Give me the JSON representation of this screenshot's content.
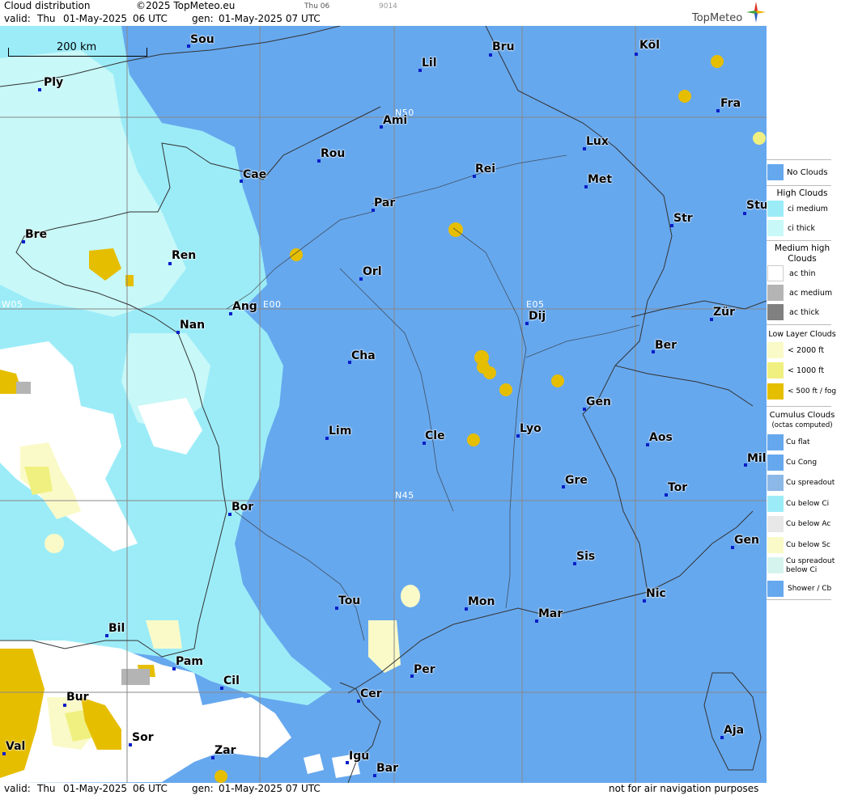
{
  "header": {
    "title": "Cloud distribution",
    "copyright": "©2025 TopMeteo.eu",
    "valid_label": "valid:",
    "valid_day": "Thu",
    "valid_date": "01-May-2025",
    "valid_time": "06 UTC",
    "gen_label": "gen:",
    "gen_value": "01-May-2025 07 UTC",
    "small_day": "Thu 06",
    "small_code": "9014",
    "logo_text": "TopMeteo"
  },
  "scale_label": "200 km",
  "grid_labels": {
    "n50": "N50",
    "n45": "N45",
    "w05": "W05",
    "e00": "E00",
    "e05": "E05"
  },
  "cities": {
    "sou": "Sou",
    "bru": "Bru",
    "kol": "Köl",
    "lil": "Lil",
    "ply": "Ply",
    "fra": "Fra",
    "ami": "Ami",
    "lux": "Lux",
    "rou": "Rou",
    "rei": "Rei",
    "cae": "Cae",
    "met": "Met",
    "par": "Par",
    "stu": "Stu",
    "str": "Str",
    "bre": "Bre",
    "ren": "Ren",
    "orl": "Orl",
    "ang": "Ang",
    "dij": "Dij",
    "zur": "Zür",
    "nan": "Nan",
    "cha": "Cha",
    "ber": "Ber",
    "gen1": "Gen",
    "lim": "Lim",
    "cle": "Cle",
    "lyo": "Lyo",
    "aos": "Aos",
    "mil": "Mil",
    "gre": "Gre",
    "tor": "Tor",
    "bor": "Bor",
    "gen2": "Gen",
    "sis": "Sis",
    "tou": "Tou",
    "mon": "Mon",
    "nic": "Nic",
    "mar": "Mar",
    "bil": "Bil",
    "pam": "Pam",
    "per": "Per",
    "cil": "Cil",
    "cer": "Cer",
    "bur": "Bur",
    "sor": "Sor",
    "aja": "Aja",
    "val": "Val",
    "zar": "Zar",
    "igu": "Igu",
    "bar": "Bar"
  },
  "footer": {
    "valid_label": "valid:",
    "valid_day": "Thu",
    "valid_date": "01-May-2025",
    "valid_time": "06 UTC",
    "gen_label": "gen:",
    "gen_value": "01-May-2025 07 UTC",
    "disclaimer": "not for air navigation purposes"
  },
  "legend": {
    "no_clouds": "No Clouds",
    "high_header": "High Clouds",
    "ci_medium": "ci medium",
    "ci_thick": "ci thick",
    "medium_header_1": "Medium high",
    "medium_header_2": "Clouds",
    "ac_thin": "ac thin",
    "ac_medium": "ac medium",
    "ac_thick": "ac thick",
    "low_header": "Low Layer Clouds",
    "lt2000": "< 2000 ft",
    "lt1000": "< 1000 ft",
    "lt500": "< 500 ft / fog",
    "cu_header_1": "Cumulus Clouds",
    "cu_header_2": "(octas computed)",
    "cu_flat": "Cu flat",
    "cu_cong": "Cu Cong",
    "cu_spreadout": "Cu spreadout",
    "cu_below_ci": "Cu below Ci",
    "cu_below_ac": "Cu below Ac",
    "cu_below_sc": "Cu below Sc",
    "cu_spread_ci_1": "Cu spreadout",
    "cu_spread_ci_2": "below Ci",
    "shower": "Shower / Cb",
    "colors": {
      "no_clouds": "#66a8ee",
      "ci_medium": "#9cecf8",
      "ci_thick": "#c8f8f8",
      "ac_thin": "#ffffff",
      "ac_medium": "#b4b4b4",
      "ac_thick": "#808080",
      "lt2000": "#fafac8",
      "lt1000": "#f0f080",
      "lt500": "#e6be00"
    }
  }
}
